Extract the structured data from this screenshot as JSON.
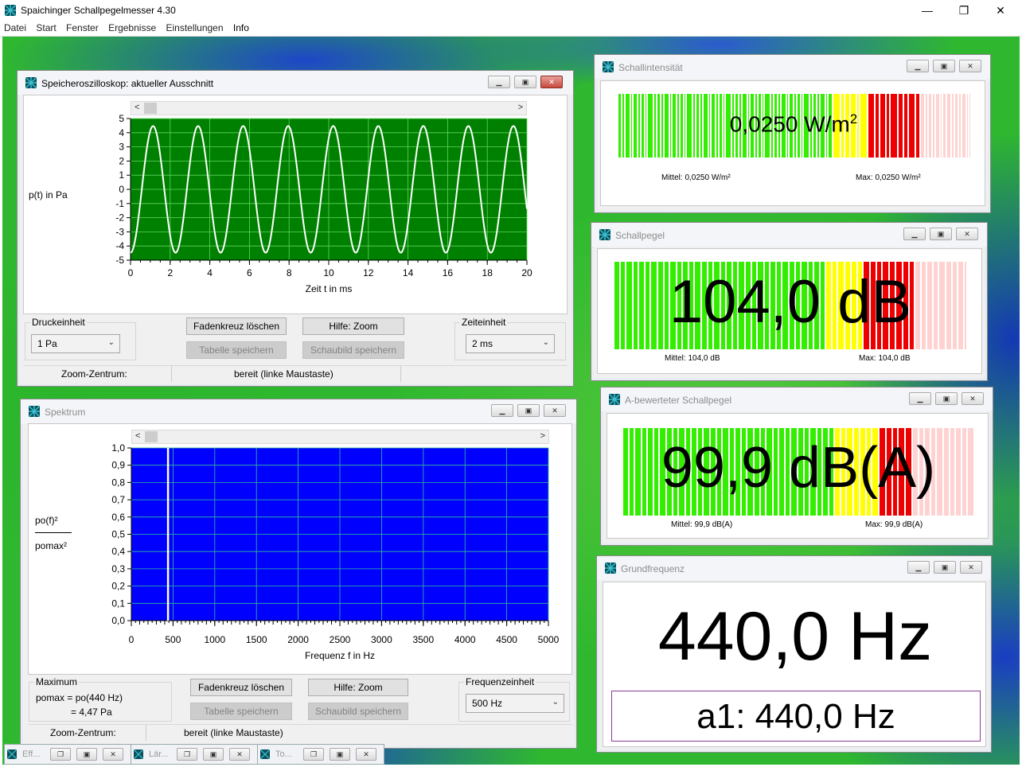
{
  "app": {
    "title": "Spaichinger Schallpegelmesser 4.30",
    "controls": {
      "minimize": "—",
      "maximize": "❐",
      "close": "✕"
    }
  },
  "menu": [
    "Datei",
    "Start",
    "Fenster",
    "Ergebnisse",
    "Einstellungen",
    "Info"
  ],
  "oscilloscope": {
    "title": "Speicheroszilloskop: aktueller Ausschnitt",
    "ylabel": "p(t) in Pa",
    "xlabel": "Zeit t in ms",
    "druck_label": "Druckeinheit",
    "druck_value": "1 Pa",
    "zeit_label": "Zeiteinheit",
    "zeit_value": "2 ms",
    "buttons": {
      "clear_crosshair": "Fadenkreuz löschen",
      "help_zoom": "Hilfe: Zoom",
      "save_table": "Tabelle speichern",
      "save_chart": "Schaubild speichern"
    },
    "status_zoom": "Zoom-Zentrum:",
    "status_text": "bereit (linke Maustaste)"
  },
  "spectrum": {
    "title": "Spektrum",
    "ylabel_num": "po(f)²",
    "ylabel_den": "pomax²",
    "xlabel": "Frequenz f in Hz",
    "max_label": "Maximum",
    "max_line1": "pomax = po(440 Hz)",
    "max_line2": "= 4,47 Pa",
    "freq_label": "Frequenzeinheit",
    "freq_value": "500 Hz",
    "buttons": {
      "clear_crosshair": "Fadenkreuz löschen",
      "help_zoom": "Hilfe: Zoom",
      "save_table": "Tabelle speichern",
      "save_chart": "Schaubild speichern"
    },
    "status_zoom": "Zoom-Zentrum:",
    "status_text": "bereit (linke Maustaste)"
  },
  "intensity": {
    "title": "Schallintensität",
    "value": "0,0250 W/m",
    "value_sup": "2",
    "mittel": "Mittel: 0,0250 W/m²",
    "max": "Max: 0,0250 W/m²"
  },
  "level": {
    "title": "Schallpegel",
    "value": "104,0 dB",
    "mittel": "Mittel: 104,0 dB",
    "max": "Max: 104,0 dB"
  },
  "alevel": {
    "title": "A-bewerteter Schallpegel",
    "value": "99,9 dB(A)",
    "mittel": "Mittel: 99,9 dB(A)",
    "max": "Max: 99,9 dB(A)"
  },
  "fundamental": {
    "title": "Grundfrequenz",
    "value": "440,0 Hz",
    "note": "a1: 440,0 Hz"
  },
  "minimized": [
    {
      "label": "Eff..."
    },
    {
      "label": "Lär..."
    },
    {
      "label": "To..."
    }
  ],
  "colors": {
    "scope_bg": "#008000",
    "scope_grid": "#5fd45f",
    "spectrum_bg": "#0000ff",
    "spectrum_grid": "#30c090",
    "meter_green": "#33ee00",
    "meter_yellow": "#ffff00",
    "meter_red": "#ee0000",
    "meter_pink": "#ffd2d2"
  },
  "chart_data": [
    {
      "type": "line",
      "title": "",
      "xlabel": "Zeit t in ms",
      "ylabel": "p(t) in Pa",
      "xlim": [
        0,
        20
      ],
      "ylim": [
        -5,
        5
      ],
      "x_ticks": [
        "0",
        "2",
        "4",
        "6",
        "8",
        "10",
        "12",
        "14",
        "16",
        "18",
        "20"
      ],
      "y_ticks": [
        "5",
        "4",
        "3",
        "2",
        "1",
        "0",
        "-1",
        "-2",
        "-3",
        "-4",
        "-5"
      ],
      "grid": true,
      "series": [
        {
          "frequency_hz": 440,
          "amplitude_pa": 4.47
        }
      ]
    },
    {
      "type": "bar",
      "title": "",
      "xlabel": "Frequenz f in Hz",
      "ylabel": "po(f)²/pomax²",
      "xlim": [
        0,
        5000
      ],
      "ylim": [
        0,
        1
      ],
      "x_ticks": [
        "0",
        "500",
        "1000",
        "1500",
        "2000",
        "2500",
        "3000",
        "3500",
        "4000",
        "4500",
        "5000"
      ],
      "y_ticks": [
        "1,0",
        "0,9",
        "0,8",
        "0,7",
        "0,6",
        "0,5",
        "0,4",
        "0,3",
        "0,2",
        "0,1",
        "0,0"
      ],
      "grid": true,
      "series": [
        {
          "x": [
            440
          ],
          "values": [
            1.0
          ]
        }
      ]
    }
  ]
}
